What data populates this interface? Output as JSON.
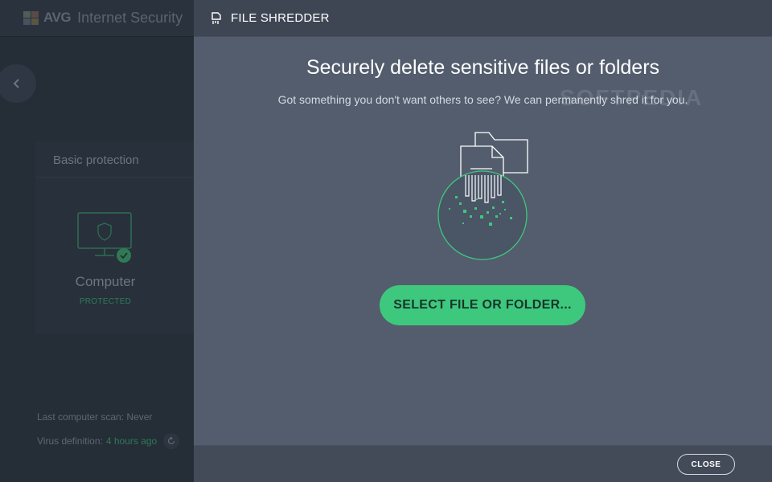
{
  "app": {
    "brand_short": "AVG",
    "brand_name": "Internet Security"
  },
  "sidebar": {
    "section_title": "Basic protection",
    "device_name": "Computer",
    "device_status": "PROTECTED",
    "last_scan_label": "Last computer scan:",
    "last_scan_value": "Never",
    "virus_def_label": "Virus definition:",
    "virus_def_value": "4 hours ago"
  },
  "dialog": {
    "title": "FILE SHREDDER",
    "headline": "Securely delete sensitive files or folders",
    "subline": "Got something you don't want others to see? We can permanently shred it for you.",
    "watermark": "SOFTPEDIA",
    "primary_button": "SELECT FILE OR FOLDER...",
    "close_button": "CLOSE"
  },
  "colors": {
    "accent_green": "#3ec87d",
    "dialog_bg": "#535d6d",
    "header_bg": "#3e4654"
  },
  "icons": {
    "header": "shredder-icon",
    "back": "chevron-left-icon",
    "device": "monitor-shield-icon",
    "status": "checkmark-icon",
    "refresh": "refresh-icon"
  }
}
